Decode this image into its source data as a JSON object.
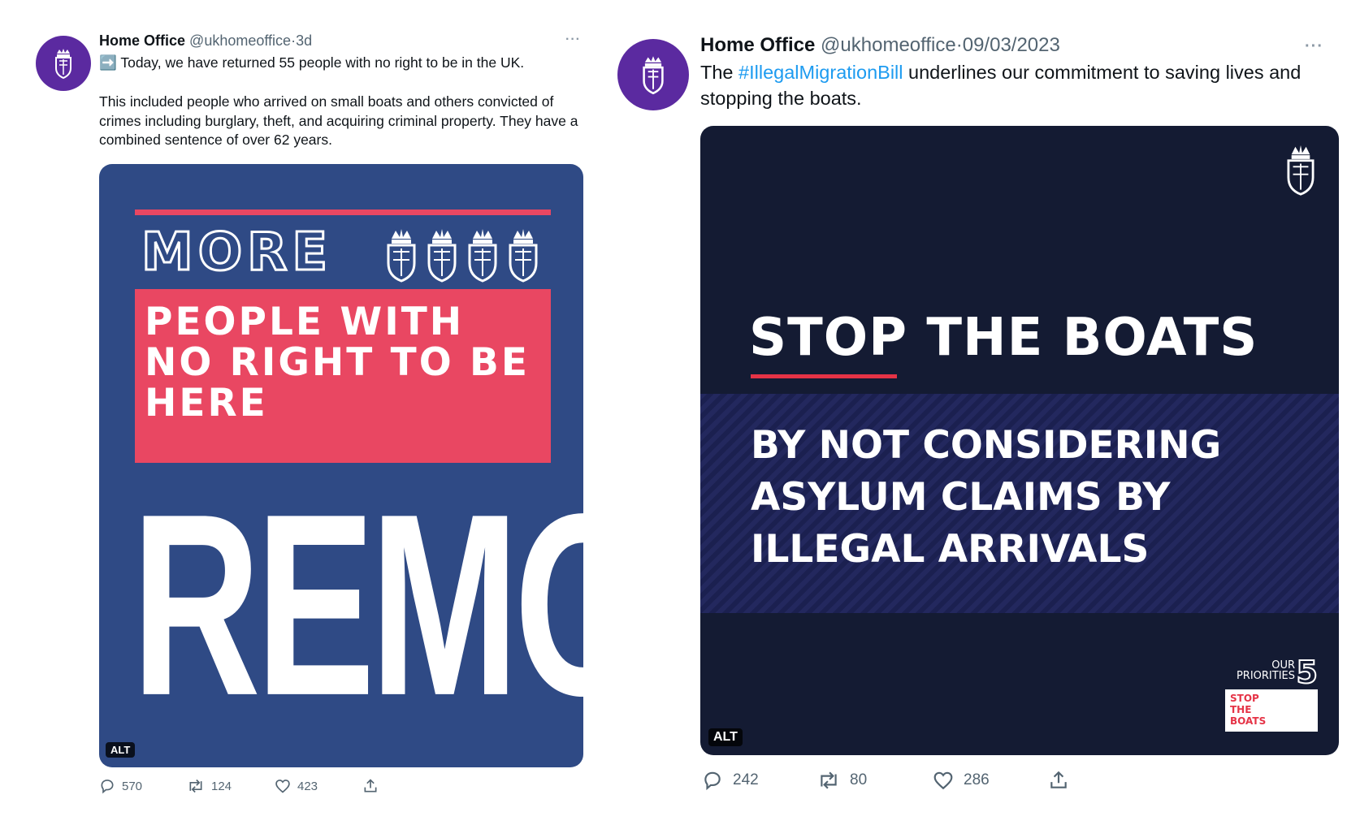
{
  "tweets": [
    {
      "author_name": "Home Office",
      "handle": "@ukhomeoffice",
      "separator": "·",
      "time": "3d",
      "more": "···",
      "text_line1": "➡️ Today, we have returned 55 people with no right to be in the UK.",
      "text_para2": "This included people who arrived on small boats and others convicted of crimes including burglary, theft, and acquiring criminal property. They have a combined sentence of over 62 years.",
      "media": {
        "headline": "MORE",
        "box_text": "PEOPLE WITH NO RIGHT TO BE HERE",
        "big_word": "REMOVED",
        "alt_badge": "ALT",
        "colors": {
          "background": "#2f4a85",
          "accent": "#e94762"
        }
      },
      "stats": {
        "replies": "570",
        "retweets": "124",
        "likes": "423"
      }
    },
    {
      "author_name": "Home Office",
      "handle": "@ukhomeoffice",
      "separator": "·",
      "time": "09/03/2023",
      "more": "···",
      "text_prefix": "The ",
      "hashtag": "#IllegalMigrationBill",
      "text_suffix": " underlines our commitment to saving lives and stopping the boats.",
      "media": {
        "headline": "STOP THE BOATS",
        "sub_text": "BY NOT CONSIDERING ASYLUM CLAIMS BY ILLEGAL ARRIVALS",
        "priorities_line1": "OUR",
        "priorities_line2": "PRIORITIES",
        "priorities_number": "5",
        "stop_line1": "STOP",
        "stop_line2": "THE",
        "stop_line3": "BOATS",
        "alt_badge": "ALT",
        "colors": {
          "background": "#141b33",
          "accent": "#e53346",
          "stripes": "#23285e"
        }
      },
      "stats": {
        "replies": "242",
        "retweets": "80",
        "likes": "286"
      }
    }
  ]
}
